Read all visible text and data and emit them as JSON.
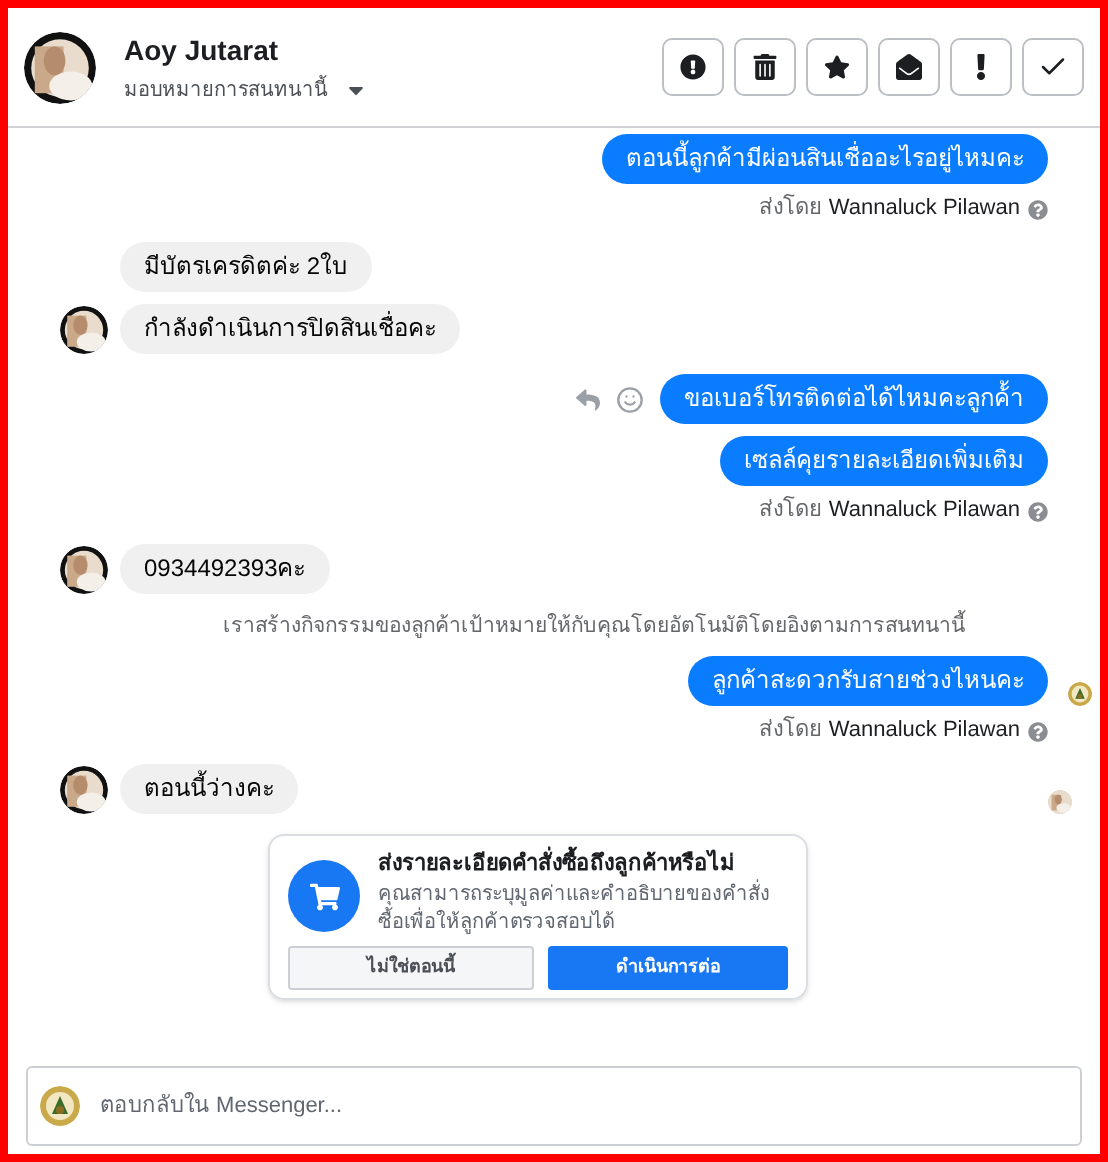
{
  "header": {
    "name": "Aoy Jutarat",
    "assign_label": "มอบหมายการสนทนานี้"
  },
  "messages": [
    {
      "kind": "outgoing",
      "bubbles": [
        "ตอนนี้ลูกค้ามีผ่อนสินเชื่ออะไรอยู่ไหมคะ"
      ],
      "sent_prefix": "ส่งโดย",
      "sender": "Wannaluck Pilawan"
    },
    {
      "kind": "incoming",
      "bubbles": [
        "มีบัตรเครดิตค่ะ 2ใบ",
        "กำลังดำเนินการปิดสินเชื่อคะ"
      ]
    },
    {
      "kind": "outgoing",
      "bubbles": [
        "ขอเบอร์โทรติดต่อได้ไหมคะลูกค้้า",
        "เซลล์คุยรายละเอียดเพิ่มเติม"
      ],
      "sent_prefix": "ส่งโดย",
      "sender": "Wannaluck Pilawan",
      "actions": true
    },
    {
      "kind": "incoming",
      "bubbles": [
        "0934492393คะ"
      ]
    },
    {
      "kind": "system",
      "text": "เราสร้างกิจกรรมของลูกค้าเป้าหมายให้กับคุณโดยอัตโนมัติโดยอิงตามการสนทนานี้"
    },
    {
      "kind": "outgoing",
      "bubbles": [
        "ลูกค้าสะดวกรับสายช่วงไหนคะ"
      ],
      "sent_prefix": "ส่งโดย",
      "sender": "Wannaluck Pilawan",
      "seen": true
    },
    {
      "kind": "incoming",
      "bubbles": [
        "ตอนนี้ว่างคะ"
      ],
      "seen": true
    }
  ],
  "order_card": {
    "title": "ส่งรายละเอียดคำสั่งซื้อถึงลูกค้าหรือไม่",
    "body": "คุณสามารถระบุมูลค่าและคำอธิบายของคำสั่งซื้อเพื่อให้ลูกค้าตรวจสอบได้",
    "buttons": [
      "ไม่ใช่ตอนนี้",
      "ดำเนินการต่อ"
    ]
  },
  "composer": {
    "placeholder": "ตอบกลับใน Messenger..."
  }
}
